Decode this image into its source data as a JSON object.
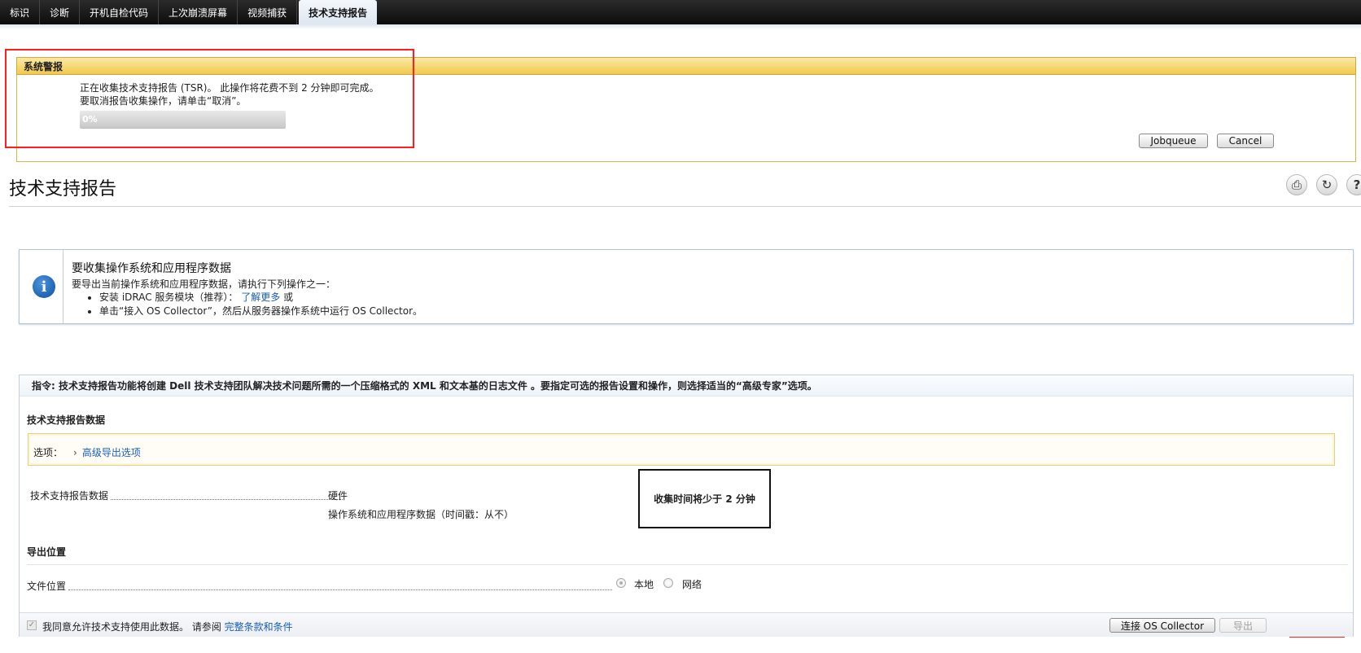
{
  "tabs": [
    {
      "label": "标识",
      "active": false
    },
    {
      "label": "诊断",
      "active": false
    },
    {
      "label": "开机自检代码",
      "active": false
    },
    {
      "label": "上次崩溃屏幕",
      "active": false
    },
    {
      "label": "视频捕获",
      "active": false
    },
    {
      "label": "技术支持报告",
      "active": true
    }
  ],
  "alert": {
    "title": "系统警报",
    "message_line1": "正在收集技术支持报告 (TSR)。 此操作将花费不到 2 分钟即可完成。",
    "message_line2": "要取消报告收集操作，请单击“取消”。",
    "progress_text": "0%",
    "progress_value": 0,
    "jobqueue_label": "Jobqueue",
    "cancel_label": "Cancel"
  },
  "page": {
    "title": "技术支持报告",
    "icons": [
      "print-icon",
      "refresh-icon",
      "help-icon"
    ]
  },
  "info": {
    "title": "要收集操作系统和应用程序数据",
    "subtitle": "要导出当前操作系统和应用程序数据，请执行下列操作之一：",
    "item1_text": "安装 iDRAC 服务模块（推荐）：",
    "item1_link": "了解更多",
    "item1_suffix": "或",
    "item2_text": "单击“接入 OS Collector”，然后从服务器操作系统中运行 OS Collector。"
  },
  "main": {
    "instruction": "指令: 技术支持报告功能将创建 Dell 技术支持团队解决技术问题所需的一个压缩格式的 XML 和文本基的日志文件 。要指定可选的报告设置和操作，则选择适当的“高级专家”选项。",
    "data_section_title": "技术支持报告数据",
    "options_label": "选项：",
    "options_link": "高级导出选项",
    "report_data_label": "技术支持报告数据",
    "report_item1": "硬件",
    "report_item2": "操作系统和应用程序数据（时间戳：从不）",
    "time_note": "收集时间将少于 2 分钟",
    "export_section_title": "导出位置",
    "file_location_label": "文件位置",
    "radio_local": "本地",
    "radio_network": "网络",
    "agree_text": "我同意允许技术支持使用此数据。 请参阅",
    "agree_link": "完整条款和条件",
    "connect_button": "连接 OS Collector",
    "export_button": "导出"
  }
}
